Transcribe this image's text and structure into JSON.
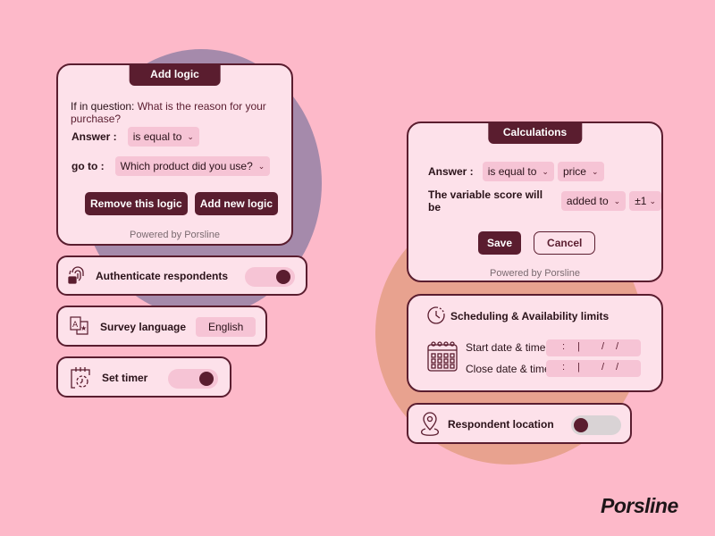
{
  "add_logic": {
    "title": "Add logic",
    "question_prefix": "If in question:",
    "question_text": "What is the reason for your purchase?",
    "answer_label": "Answer :",
    "answer_select": "is equal to",
    "goto_label": "go to :",
    "goto_select": "Which product did you use?",
    "remove_button": "Remove this logic",
    "add_button": "Add new logic",
    "powered_by": "Powered by Porsline"
  },
  "authenticate": {
    "label": "Authenticate respondents",
    "toggle_on": true
  },
  "survey_language": {
    "label": "Survey language",
    "value": "English"
  },
  "set_timer": {
    "label": "Set timer",
    "toggle_on": true
  },
  "calculations": {
    "title": "Calculations",
    "answer_label": "Answer :",
    "operator_select": "is equal to",
    "value_select": "price",
    "variable_label": "The variable score will be",
    "action_select": "added to",
    "amount_select": "±1",
    "save_button": "Save",
    "cancel_button": "Cancel",
    "powered_by": "Powered by Porsline"
  },
  "scheduling": {
    "title": "Scheduling & Availability limits",
    "start_label": "Start date & time",
    "close_label": "Close date & time",
    "time_sep": ":",
    "field_sep": "|",
    "date_sep1": "/",
    "date_sep2": "/"
  },
  "location": {
    "label": "Respondent location",
    "toggle_on": false
  },
  "brand": {
    "logo": "Porsline"
  },
  "colors": {
    "background": "#fdb9c9",
    "primary": "#5a1d2f",
    "card": "#fde1ea",
    "select": "#f6c4d5"
  }
}
